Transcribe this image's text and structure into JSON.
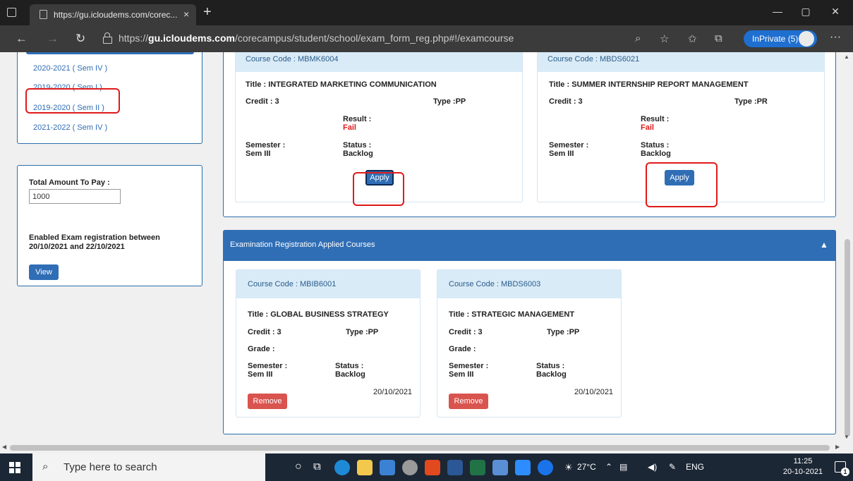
{
  "browser": {
    "tab_title": "https://gu.icloudems.com/corec...",
    "tab_close": "×",
    "new_tab": "+",
    "url_domain": "gu.icloudems.com",
    "url_prefix": "https://",
    "url_path": "/corecampus/student/school/exam_form_reg.php#!/examcourse",
    "inprivate_label": "InPrivate (5)",
    "minimize": "—",
    "maximize": "▢",
    "close": "✕"
  },
  "sidebar": {
    "semesters": [
      "2020-2021 ( Sem IV )",
      "2019-2020 ( Sem I )",
      "2019-2020 ( Sem II )",
      "2021-2022 ( Sem IV )"
    ],
    "total_amount_label": "Total Amount To Pay :",
    "total_amount_value": "1000",
    "enabled_text": "Enabled Exam registration between 20/10/2021 and 22/10/2021",
    "view_button": "View"
  },
  "available_courses": [
    {
      "code": "Course Code : MBMK6004",
      "title": "Title : INTEGRATED MARKETING COMMUNICATION",
      "credit": "Credit : 3",
      "type": "Type :PP",
      "result_label": "Result :",
      "result_value": "Fail",
      "semester_label": "Semester :",
      "semester_value": "Sem III",
      "status_label": "Status :",
      "status_value": "Backlog",
      "button": "Apply"
    },
    {
      "code": "Course Code : MBDS6021",
      "title": "Title : SUMMER INTERNSHIP REPORT MANAGEMENT",
      "credit": "Credit : 3",
      "type": "Type :PR",
      "result_label": "Result :",
      "result_value": "Fail",
      "semester_label": "Semester :",
      "semester_value": "Sem III",
      "status_label": "Status :",
      "status_value": "Backlog",
      "button": "Apply"
    }
  ],
  "applied_section": {
    "heading": "Examination Registration Applied Courses",
    "courses": [
      {
        "code": "Course Code : MBIB6001",
        "title": "Title : GLOBAL BUSINESS STRATEGY",
        "credit": "Credit : 3",
        "type": "Type :PP",
        "grade": "Grade :",
        "semester_label": "Semester :",
        "semester_value": "Sem III",
        "status_label": "Status :",
        "status_value": "Backlog",
        "date": "20/10/2021",
        "button": "Remove"
      },
      {
        "code": "Course Code : MBDS6003",
        "title": "Title : STRATEGIC MANAGEMENT",
        "credit": "Credit : 3",
        "type": "Type :PP",
        "grade": "Grade :",
        "semester_label": "Semester :",
        "semester_value": "Sem III",
        "status_label": "Status :",
        "status_value": "Backlog",
        "date": "20/10/2021",
        "button": "Remove"
      }
    ]
  },
  "taskbar": {
    "search_placeholder": "Type here to search",
    "weather": "27°C",
    "language": "ENG",
    "time": "11:25",
    "date": "20-10-2021",
    "notifications": "1"
  },
  "colors": {
    "accent": "#2f6db5",
    "fail": "#e01a1a",
    "remove": "#d9534f",
    "card_header": "#d9ebf7"
  }
}
